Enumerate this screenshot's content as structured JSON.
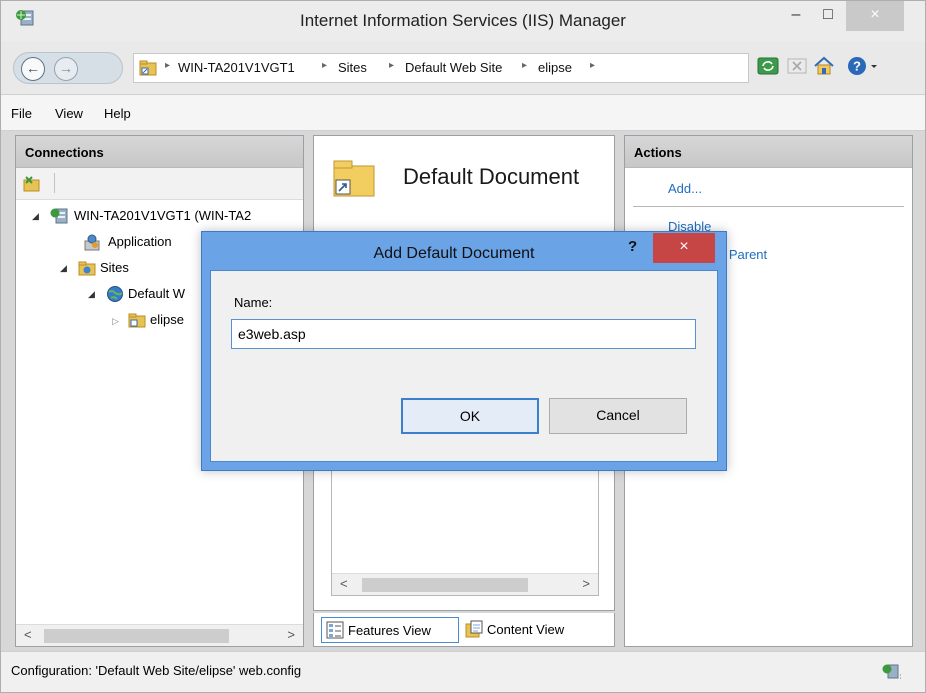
{
  "window": {
    "title": "Internet Information Services (IIS) Manager",
    "minimize_label": "–",
    "maximize_label": "□",
    "close_label": "×"
  },
  "address": {
    "breadcrumbs": [
      "WIN-TA201V1VGT1",
      "Sites",
      "Default Web Site",
      "elipse"
    ],
    "separator": "▸"
  },
  "menu": {
    "items": [
      "File",
      "View",
      "Help"
    ]
  },
  "connections": {
    "header": "Connections",
    "tree": [
      {
        "label": "WIN-TA201V1VGT1 (WIN-TA2",
        "expanded": true
      },
      {
        "label": "Application",
        "expanded": false
      },
      {
        "label": "Sites",
        "expanded": true
      },
      {
        "label": "Default W",
        "expanded": true
      },
      {
        "label": "elipse",
        "expanded": false
      }
    ],
    "scroll_left": "<",
    "scroll_right": ">"
  },
  "feature": {
    "title": "Default Document",
    "scroll_left": "<",
    "scroll_right": ">"
  },
  "view_tabs": {
    "features_label": "Features View",
    "content_label": "Content View"
  },
  "actions": {
    "header": "Actions",
    "items": [
      "Add...",
      "Disable",
      "o Parent"
    ]
  },
  "status": {
    "text": "Configuration: 'Default Web Site/elipse' web.config"
  },
  "dialog": {
    "title": "Add Default Document",
    "help_label": "?",
    "close_label": "×",
    "name_label": "Name:",
    "name_value": "e3web.asp",
    "ok_label": "OK",
    "cancel_label": "Cancel"
  },
  "colors": {
    "accent": "#1f6dbf",
    "dialog_frame": "#6aa3e6",
    "dialog_close": "#c64645"
  }
}
